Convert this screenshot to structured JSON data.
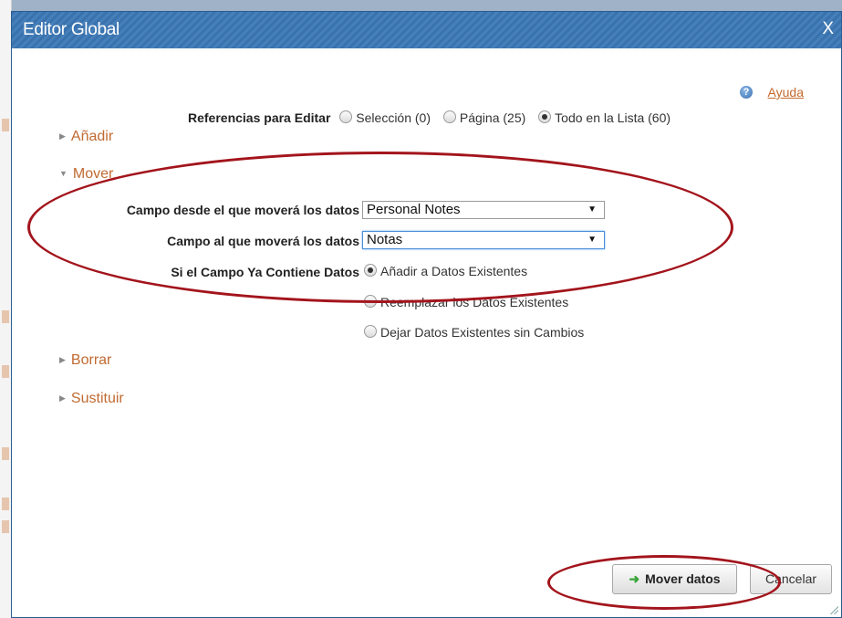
{
  "dialog": {
    "title": "Editor Global",
    "close_label": "X",
    "help_label": "Ayuda",
    "help_icon": "?"
  },
  "references": {
    "label": "Referencias para Editar",
    "options": [
      {
        "label": "Selección (0)",
        "selected": false
      },
      {
        "label": "Página (25)",
        "selected": false
      },
      {
        "label": "Todo en la Lista (60)",
        "selected": true
      }
    ]
  },
  "sections": {
    "add": "Añadir",
    "move": "Mover",
    "delete": "Borrar",
    "replace": "Sustituir"
  },
  "move": {
    "from_label": "Campo desde el que moverá los datos",
    "from_value": "Personal Notes",
    "to_label": "Campo al que moverá los datos",
    "to_value": "Notas",
    "exists_label": "Si el Campo Ya Contiene Datos",
    "exists_options": [
      {
        "label": "Añadir a Datos Existentes",
        "selected": true
      },
      {
        "label": "Reemplazar los Datos Existentes",
        "selected": false
      },
      {
        "label": "Dejar Datos Existentes sin Cambios",
        "selected": false
      }
    ]
  },
  "buttons": {
    "move_data": "Mover datos",
    "cancel": "Cancelar"
  },
  "colors": {
    "titlebar": "#3a72ad",
    "section_link": "#c06a31",
    "annotation_ellipse": "#a3141c"
  }
}
